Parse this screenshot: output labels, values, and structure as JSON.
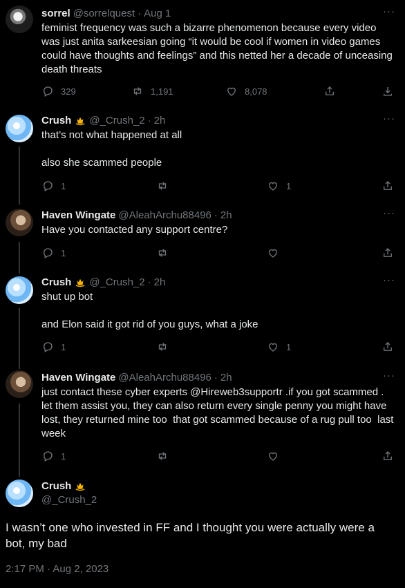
{
  "tweets": [
    {
      "name": "sorrel",
      "handle": "@sorrelquest",
      "time": "Aug 1",
      "text": "feminist frequency was such a bizarre phenomenon because every video was just anita sarkeesian going “it would be cool if women in video games could have thoughts and feelings” and this netted her a decade of unceasing death threats",
      "replies": "329",
      "reposts": "1,191",
      "likes": "8,078"
    },
    {
      "name": "Crush",
      "handle": "@_Crush_2",
      "time": "2h",
      "text_p1": "that’s not what happened at all",
      "text_p2": "also she scammed people",
      "replies": "1",
      "likes": "1"
    },
    {
      "name": "Haven Wingate",
      "handle": "@AleahArchu88496",
      "time": "2h",
      "text": "Have you contacted any support centre?",
      "replies": "1"
    },
    {
      "name": "Crush",
      "handle": "@_Crush_2",
      "time": "2h",
      "text_p1": "shut up bot",
      "text_p2": "and Elon said it got rid of you guys, what a joke",
      "replies": "1",
      "likes": "1"
    },
    {
      "name": "Haven Wingate",
      "handle": "@AleahArchu88496",
      "time": "2h",
      "text": "just contact these cyber experts @Hireweb3supportr .if you got scammed . let them assist you, they can also return every single penny you might have lost, they returned mine too  that got scammed because of a rug pull too  last week",
      "replies": "1"
    }
  ],
  "main": {
    "name": "Crush",
    "handle": "@_Crush_2",
    "text": "I wasn’t one who invested in FF and I thought you were actually were a bot, my bad",
    "timestamp": "2:17 PM · Aug 2, 2023"
  },
  "ui": {
    "separator": "·",
    "more": "···"
  },
  "icons": {
    "reply": "reply-icon",
    "repost": "repost-icon",
    "like": "heart-icon",
    "share": "share-icon",
    "bookmark": "bookmark-icon",
    "badge": "crown-badge-icon"
  },
  "colors": {
    "background": "#000000",
    "text": "#e7e9ea",
    "muted": "#71767b",
    "divider": "#333639",
    "badge": "#f4b400"
  }
}
